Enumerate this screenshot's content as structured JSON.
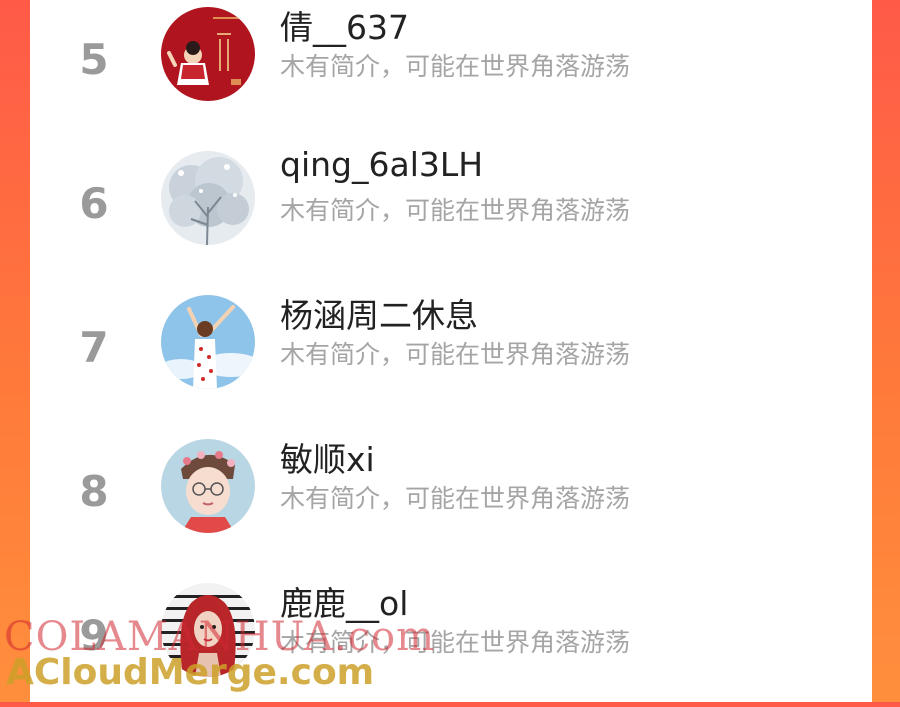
{
  "ranking": [
    {
      "rank": "5",
      "name": "倩__637",
      "bio": "木有简介，可能在世界角落游荡",
      "avatar": "red-new-year-avatar"
    },
    {
      "rank": "6",
      "name": "qing_6al3LH",
      "bio": "木有简介，可能在世界角落游荡",
      "avatar": "snowy-tree-avatar"
    },
    {
      "rank": "7",
      "name": "杨涵周二休息",
      "bio": "木有简介，可能在世界角落游荡",
      "avatar": "sky-girl-avatar"
    },
    {
      "rank": "8",
      "name": "敏顺xi",
      "bio": "木有简介，可能在世界角落游荡",
      "avatar": "boy-with-glasses-avatar"
    },
    {
      "rank": "9",
      "name": "鹿鹿__ol",
      "bio": "木有简介，可能在世界角落游荡",
      "avatar": "red-hair-girl-avatar"
    }
  ],
  "watermark": {
    "line1": "COLAMANHUA.com",
    "line2": "ACloudMerge.com"
  },
  "colors": {
    "background_gradient_start": "#ff5a48",
    "background_gradient_end": "#ff8f3c",
    "card": "#ffffff",
    "rank_text": "#9a9a9a",
    "name_text": "#222222",
    "bio_text": "#a5a5a5"
  }
}
